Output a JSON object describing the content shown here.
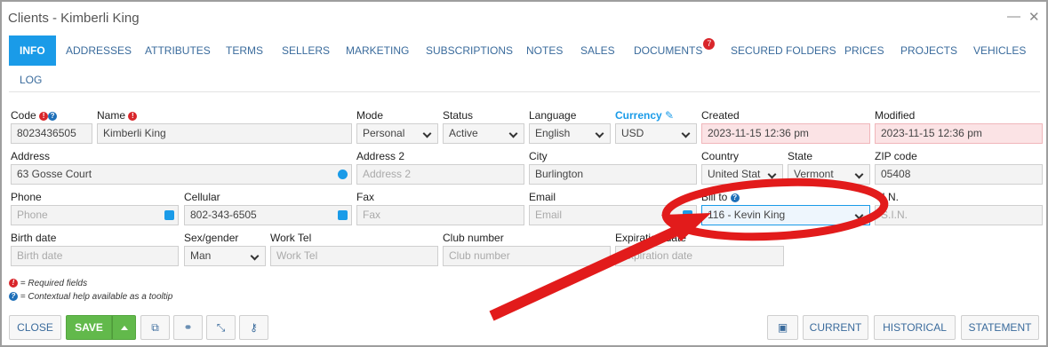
{
  "window": {
    "title": "Clients - Kimberli King",
    "minimize": "—",
    "close": "✕"
  },
  "tabs": [
    {
      "label": "INFO"
    },
    {
      "label": "ADDRESSES"
    },
    {
      "label": "ATTRIBUTES"
    },
    {
      "label": "TERMS"
    },
    {
      "label": "SELLERS"
    },
    {
      "label": "MARKETING"
    },
    {
      "label": "SUBSCRIPTIONS"
    },
    {
      "label": "NOTES"
    },
    {
      "label": "SALES"
    },
    {
      "label": "DOCUMENTS",
      "badge": "7"
    },
    {
      "label": "SECURED FOLDERS"
    },
    {
      "label": "PRICES"
    },
    {
      "label": "PROJECTS"
    },
    {
      "label": "VEHICLES"
    },
    {
      "label": "LOG"
    }
  ],
  "form": {
    "code": {
      "label": "Code",
      "value": "8023436505"
    },
    "name": {
      "label": "Name",
      "value": "Kimberli King"
    },
    "mode": {
      "label": "Mode",
      "value": "Personal"
    },
    "status": {
      "label": "Status",
      "value": "Active"
    },
    "language": {
      "label": "Language",
      "value": "English"
    },
    "currency": {
      "label": "Currency",
      "value": "USD"
    },
    "created": {
      "label": "Created",
      "value": "2023-11-15 12:36 pm"
    },
    "modified": {
      "label": "Modified",
      "value": "2023-11-15 12:36 pm"
    },
    "address": {
      "label": "Address",
      "value": "63 Gosse Court"
    },
    "address2": {
      "label": "Address 2",
      "placeholder": "Address 2"
    },
    "city": {
      "label": "City",
      "value": "Burlington"
    },
    "country": {
      "label": "Country",
      "value": "United Stat"
    },
    "state": {
      "label": "State",
      "value": "Vermont"
    },
    "zip": {
      "label": "ZIP code",
      "value": "05408"
    },
    "phone": {
      "label": "Phone",
      "placeholder": "Phone"
    },
    "cellular": {
      "label": "Cellular",
      "value": "802-343-6505"
    },
    "fax": {
      "label": "Fax",
      "placeholder": "Fax"
    },
    "email": {
      "label": "Email",
      "placeholder": "Email"
    },
    "billto": {
      "label": "Bill to",
      "value": "116 - Kevin King"
    },
    "sin": {
      "label": ".I.N.",
      "placeholder": "S.I.N."
    },
    "birthdate": {
      "label": "Birth date",
      "placeholder": "Birth date"
    },
    "sexgender": {
      "label": "Sex/gender",
      "value": "Man"
    },
    "worktel": {
      "label": "Work Tel",
      "placeholder": "Work Tel"
    },
    "clubnumber": {
      "label": "Club number",
      "placeholder": "Club number"
    },
    "expiration": {
      "label": "Expiration date",
      "placeholder": "Expiration date"
    }
  },
  "legend": {
    "required": "= Required fields",
    "help": "= Contextual help available as a tooltip"
  },
  "footer": {
    "close": "CLOSE",
    "save": "SAVE",
    "current": "CURRENT",
    "historical": "HISTORICAL",
    "statement": "STATEMENT"
  },
  "colors": {
    "accent": "#1a9be8",
    "save": "#62b94b",
    "annotation": "#e21b1b"
  }
}
